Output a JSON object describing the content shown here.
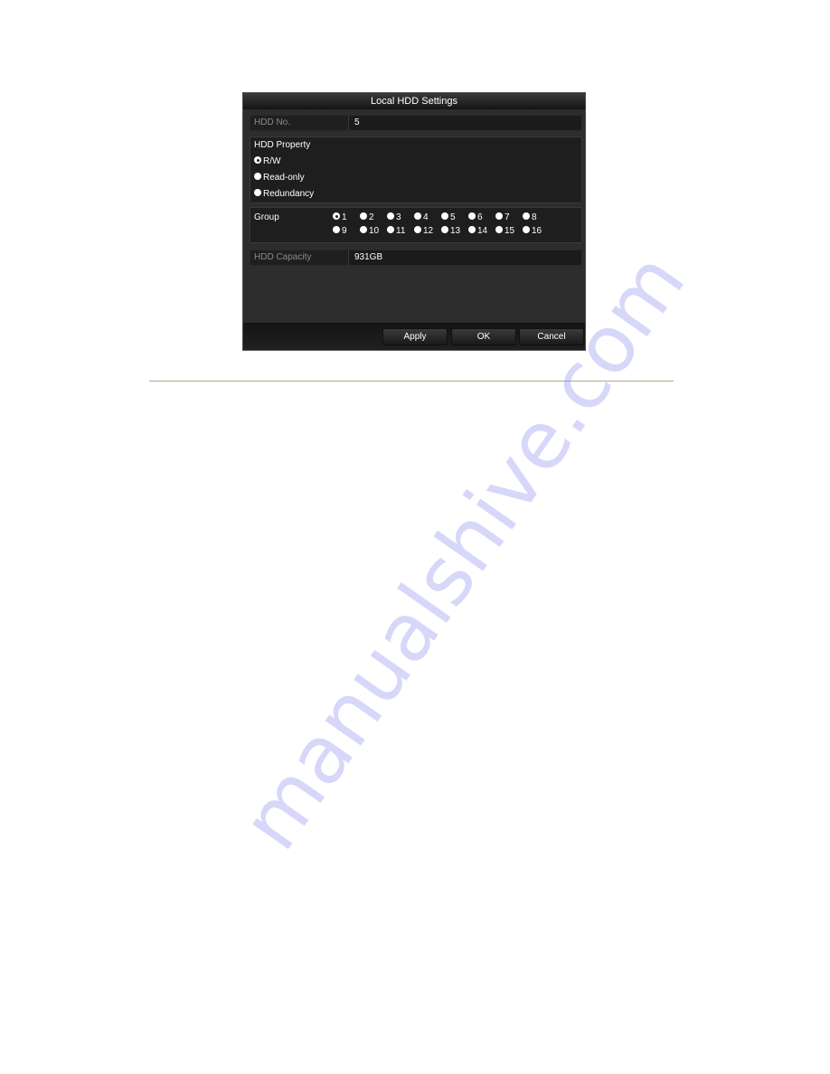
{
  "dialog": {
    "title": "Local HDD Settings",
    "hdd_no": {
      "label": "HDD No.",
      "value": "5"
    },
    "hdd_property": {
      "label": "HDD Property",
      "options": [
        {
          "label": "R/W",
          "selected": true
        },
        {
          "label": "Read-only",
          "selected": false
        },
        {
          "label": "Redundancy",
          "selected": false
        }
      ]
    },
    "group": {
      "label": "Group",
      "selected": "1",
      "options": [
        "1",
        "2",
        "3",
        "4",
        "5",
        "6",
        "7",
        "8",
        "9",
        "10",
        "11",
        "12",
        "13",
        "14",
        "15",
        "16"
      ]
    },
    "hdd_capacity": {
      "label": "HDD Capacity",
      "value": "931GB"
    },
    "buttons": {
      "apply": "Apply",
      "ok": "OK",
      "cancel": "Cancel"
    }
  },
  "watermark": "manualshive.com"
}
